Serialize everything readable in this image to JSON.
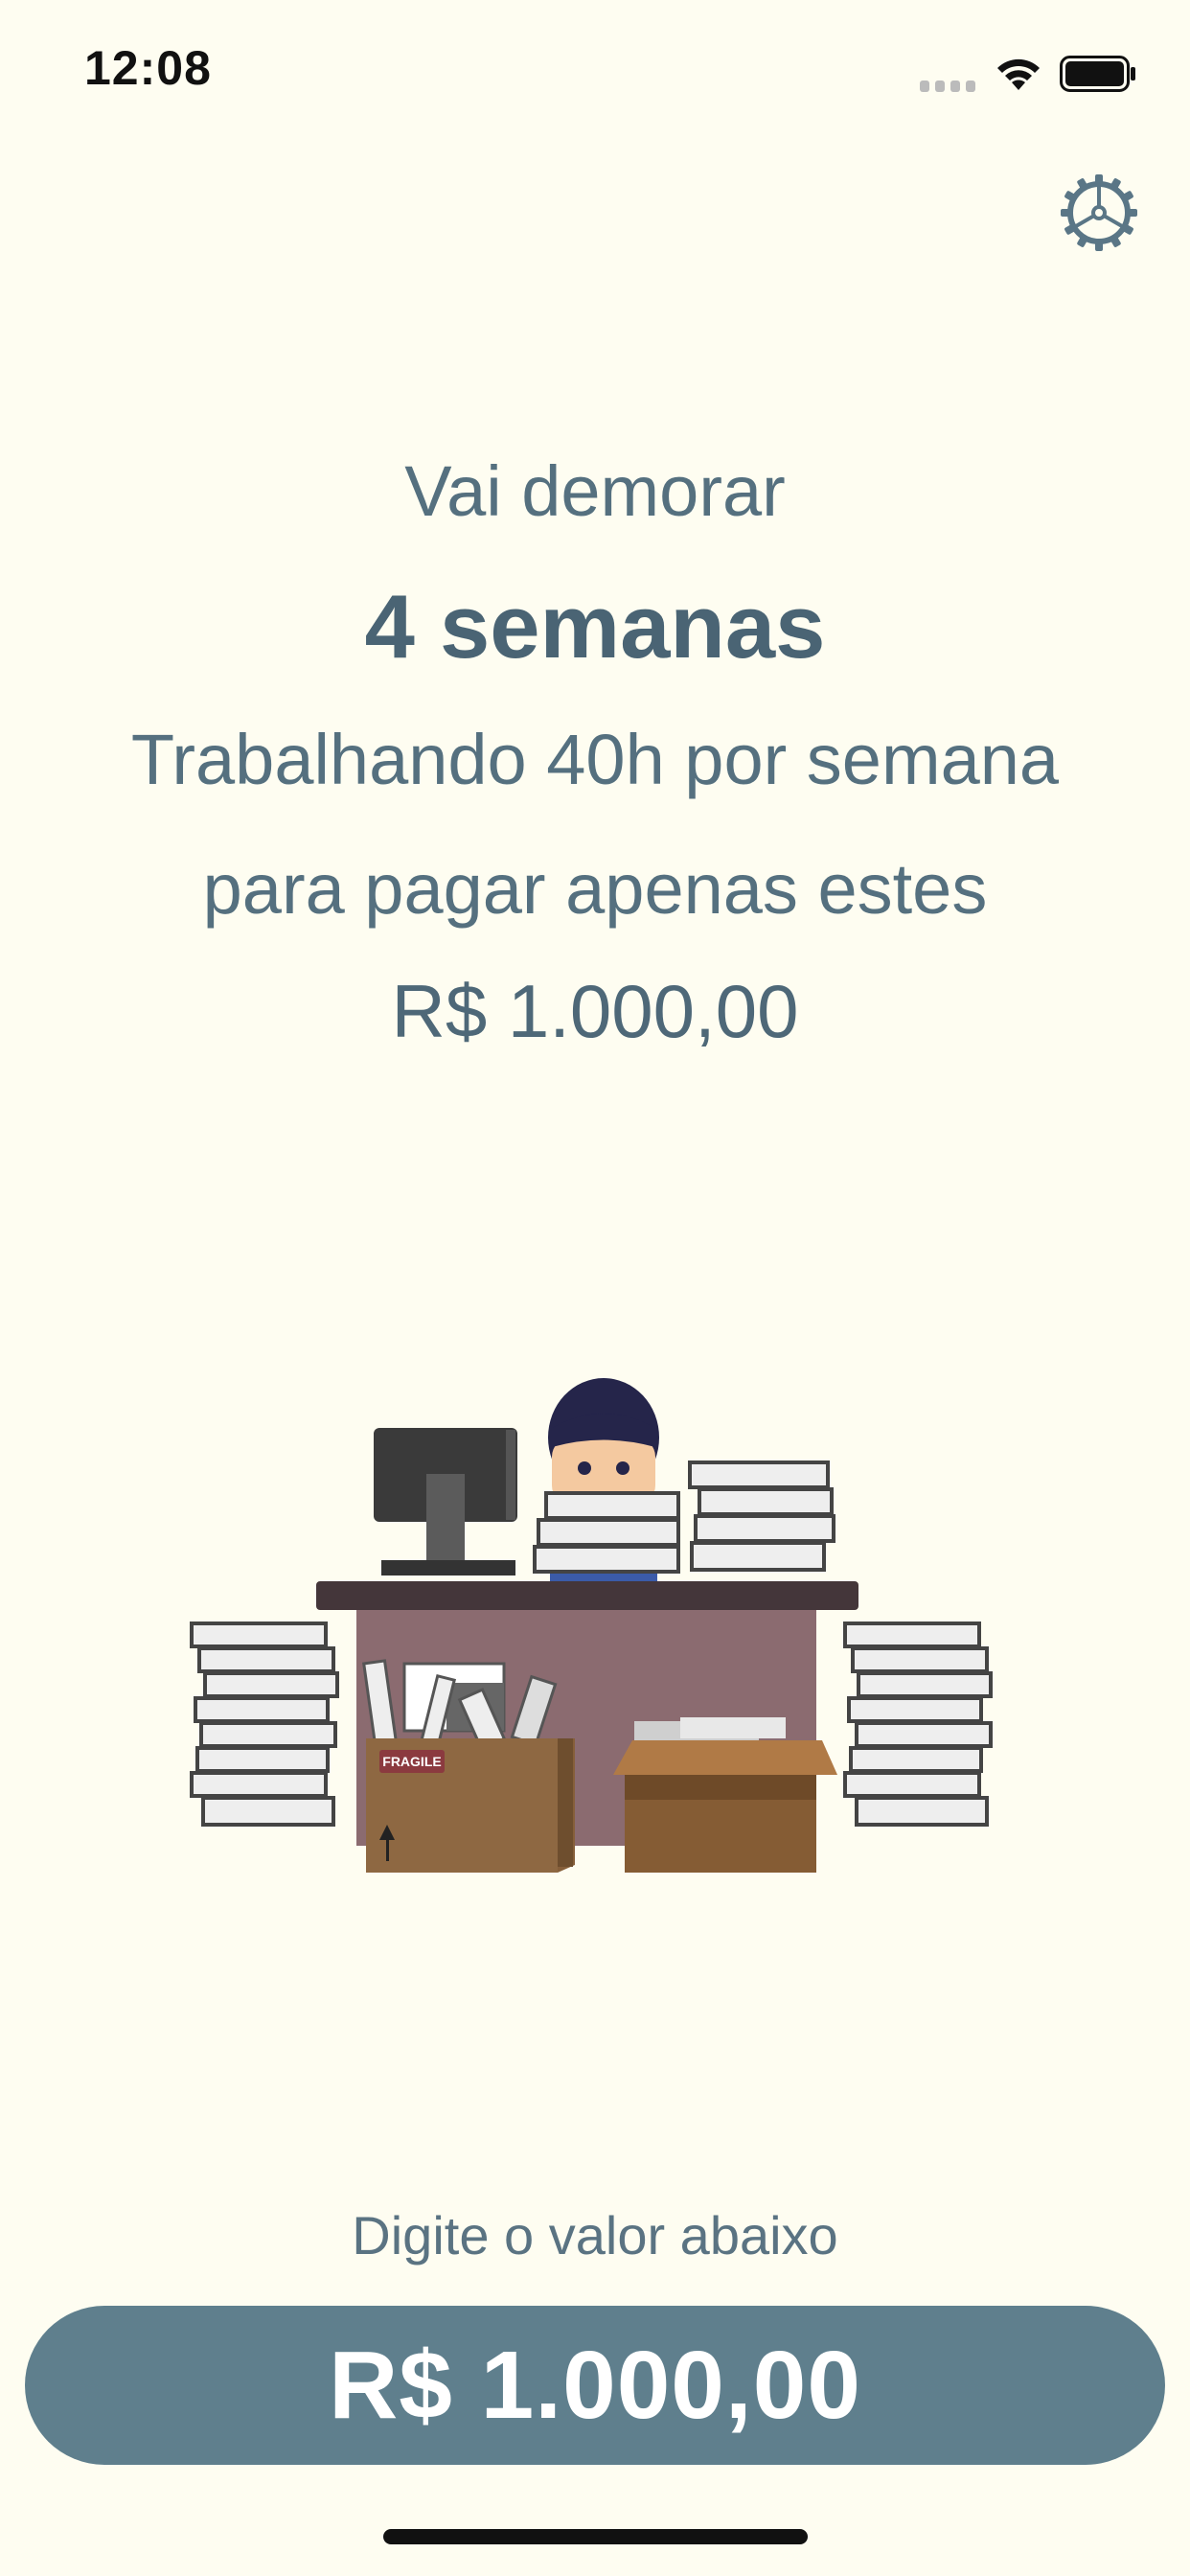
{
  "status_bar": {
    "time": "12:08",
    "icons": [
      "signal-icon",
      "wifi-icon",
      "battery-icon"
    ]
  },
  "header": {
    "settings_icon": "gear-icon"
  },
  "result": {
    "intro": "Vai demorar",
    "duration": "4 semanas",
    "work_line": "Trabalhando 40h por semana",
    "purpose_line": "para pagar apenas estes",
    "amount": "R$ 1.000,00"
  },
  "illustration": {
    "box_label": "FRAGILE"
  },
  "input": {
    "prompt": "Digite o valor abaixo",
    "value": "R$ 1.000,00"
  },
  "colors": {
    "background": "#FEFDF1",
    "text": "#4E6878",
    "field": "#5F7F8D"
  }
}
